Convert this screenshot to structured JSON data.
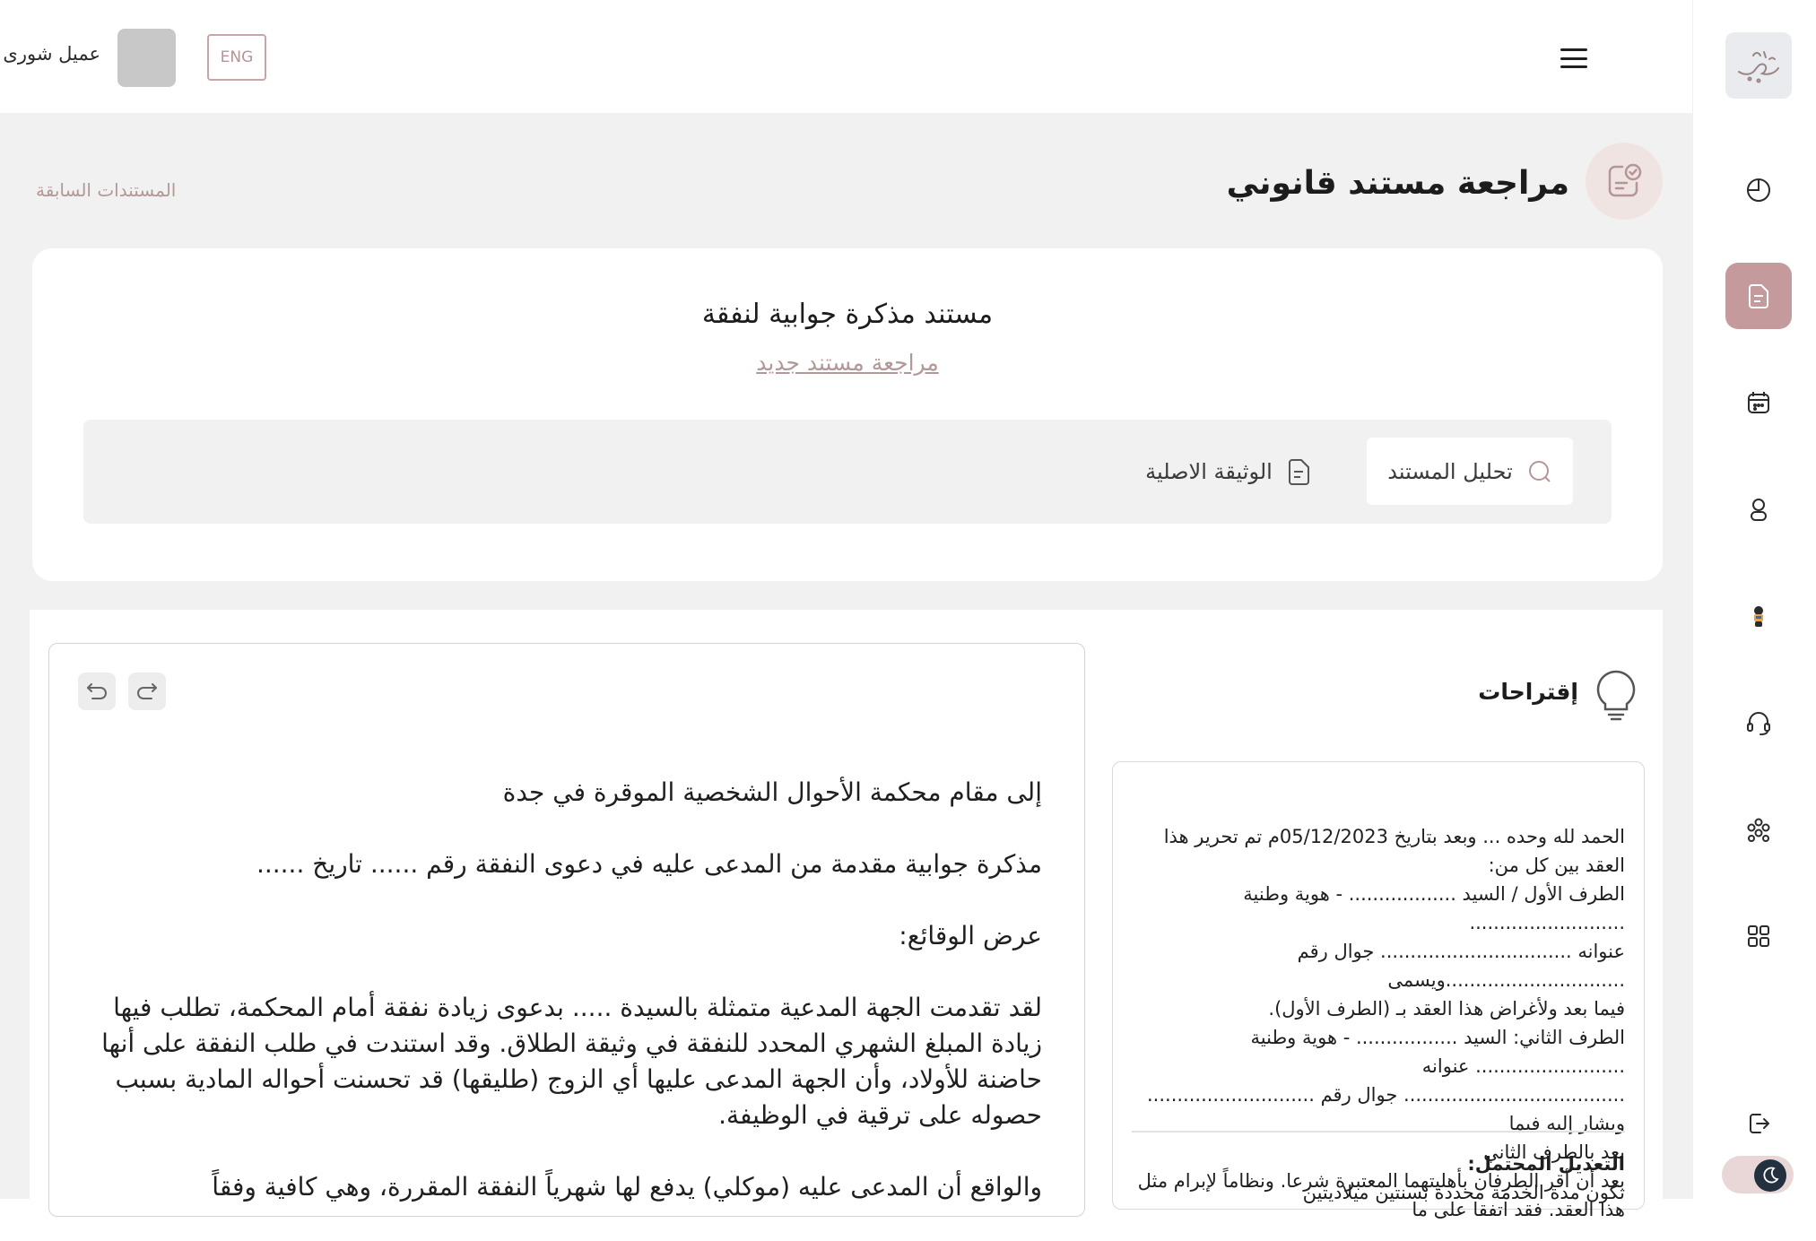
{
  "app": {
    "user_name": "عميل شورى",
    "lang_button": "ENG"
  },
  "sidebar": {
    "items": [
      {
        "icon": "pie-chart-icon"
      },
      {
        "icon": "document-icon",
        "active": true
      },
      {
        "icon": "calendar-icon"
      },
      {
        "icon": "user-icon"
      },
      {
        "icon": "bot-avatar-icon"
      },
      {
        "icon": "headset-icon"
      },
      {
        "icon": "people-group-icon"
      },
      {
        "icon": "grid-icon"
      },
      {
        "icon": "logout-icon"
      }
    ],
    "theme_toggle": "moon-icon"
  },
  "page": {
    "title": "مراجعة مستند قانوني",
    "prev_docs_link": "المستندات السابقة"
  },
  "document": {
    "title": "مستند مذكرة جوابية لنفقة",
    "new_review_link": "مراجعة مستند جديد",
    "tabs": {
      "analysis": "تحليل المستند",
      "original": "الوثيقة الاصلية"
    }
  },
  "suggestions": {
    "title": "إقتراحات",
    "lines": [
      "الحمد لله وحده ... وبعد بتاريخ 05/12/2023م تم تحرير هذا",
      "العقد بين كل من:",
      "الطرف الأول / السيد .................. - هوية وطنية ..........................",
      "عنوانه ................................ جوال رقم ..............................ويسمى",
      "فيما بعد ولأغراض هذا العقد بـ (الطرف الأول).",
      "الطرف الثاني: السيد ................. - هوية وطنية ......................... عنوانه",
      "..................................... جوال رقم ............................ ويشار إليه فيما",
      "بعد بالطرف الثاني",
      "بعد أن أقر الطرفان بأهليتهما المعتبرة شرعا. ونظاماً لإبرام مثل",
      "هذا العقد. فقد اتفقا على ما"
    ],
    "modification_label": "التعديل المحتمل:",
    "modification_text": "تكون مدة الخدمة محددة بسنتين ميلاديتين"
  },
  "editor": {
    "paragraphs": [
      "إلى مقام محكمة الأحوال الشخصية الموقرة في جدة",
      "مذكرة جوابية مقدمة من المدعى عليه في دعوى النفقة رقم ...... تاريخ ......",
      "عرض الوقائع:",
      "لقد تقدمت الجهة المدعية متمثلة بالسيدة ..... بدعوى زيادة نفقة أمام المحكمة، تطلب فيها زيادة المبلغ الشهري المحدد للنفقة في وثيقة الطلاق. وقد استندت في طلب النفقة على أنها حاضنة للأولاد، وأن الجهة المدعى عليها أي الزوج (طليقها) قد تحسنت أحواله المادية بسبب حصوله على ترقية في الوظيفة.",
      "والواقع أن المدعى عليه (موكلي) يدفع لها شهرياً النفقة المقررة، وهي كافية وفقاً"
    ]
  }
}
